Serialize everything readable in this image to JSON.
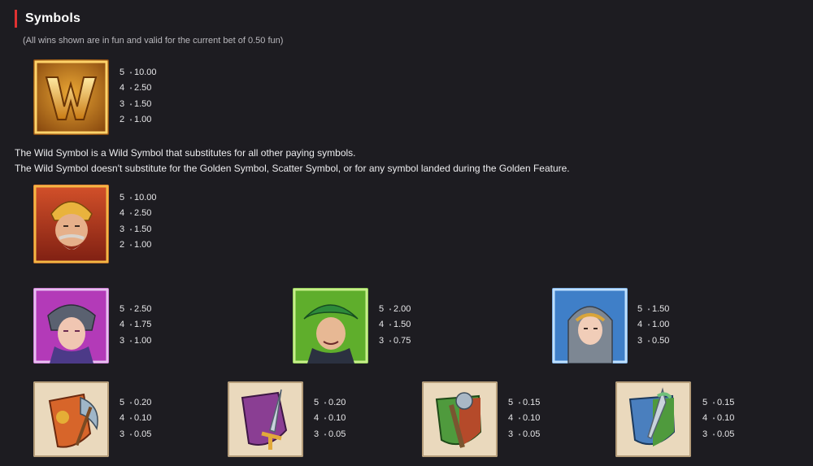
{
  "section": {
    "title": "Symbols",
    "note": "(All wins shown are in fun and valid for the current bet of 0.50 fun)"
  },
  "colors": {
    "accent": "#e03232",
    "background": "#1d1c21",
    "text": "#e9e9ea"
  },
  "wild": {
    "icon": "wild-w-symbol",
    "pays": [
      {
        "count": "5",
        "value": "10.00"
      },
      {
        "count": "4",
        "value": "2.50"
      },
      {
        "count": "3",
        "value": "1.50"
      },
      {
        "count": "2",
        "value": "1.00"
      }
    ],
    "description_1": "The Wild Symbol is a Wild Symbol that substitutes for all other paying symbols.",
    "description_2": "The Wild Symbol doesn't substitute for the Golden Symbol, Scatter Symbol, or for any symbol landed during the Golden Feature."
  },
  "king": {
    "icon": "bearded-king-symbol",
    "pays": [
      {
        "count": "5",
        "value": "10.00"
      },
      {
        "count": "4",
        "value": "2.50"
      },
      {
        "count": "3",
        "value": "1.50"
      },
      {
        "count": "2",
        "value": "1.00"
      }
    ]
  },
  "characters": [
    {
      "icon": "purple-knight-woman-symbol",
      "pays": [
        {
          "count": "5",
          "value": "2.50"
        },
        {
          "count": "4",
          "value": "1.75"
        },
        {
          "count": "3",
          "value": "1.00"
        }
      ]
    },
    {
      "icon": "green-hat-jester-symbol",
      "pays": [
        {
          "count": "5",
          "value": "2.00"
        },
        {
          "count": "4",
          "value": "1.50"
        },
        {
          "count": "3",
          "value": "0.75"
        }
      ]
    },
    {
      "icon": "chainmail-knight-symbol",
      "pays": [
        {
          "count": "5",
          "value": "1.50"
        },
        {
          "count": "4",
          "value": "1.00"
        },
        {
          "count": "3",
          "value": "0.50"
        }
      ]
    }
  ],
  "shields": [
    {
      "icon": "orange-shield-axe-symbol",
      "pays": [
        {
          "count": "5",
          "value": "0.20"
        },
        {
          "count": "4",
          "value": "0.10"
        },
        {
          "count": "3",
          "value": "0.05"
        }
      ]
    },
    {
      "icon": "purple-shield-sword-symbol",
      "pays": [
        {
          "count": "5",
          "value": "0.20"
        },
        {
          "count": "4",
          "value": "0.10"
        },
        {
          "count": "3",
          "value": "0.05"
        }
      ]
    },
    {
      "icon": "green-shield-mace-symbol",
      "pays": [
        {
          "count": "5",
          "value": "0.15"
        },
        {
          "count": "4",
          "value": "0.10"
        },
        {
          "count": "3",
          "value": "0.05"
        }
      ]
    },
    {
      "icon": "blue-shield-dagger-symbol",
      "pays": [
        {
          "count": "5",
          "value": "0.15"
        },
        {
          "count": "4",
          "value": "0.10"
        },
        {
          "count": "3",
          "value": "0.05"
        }
      ]
    }
  ]
}
